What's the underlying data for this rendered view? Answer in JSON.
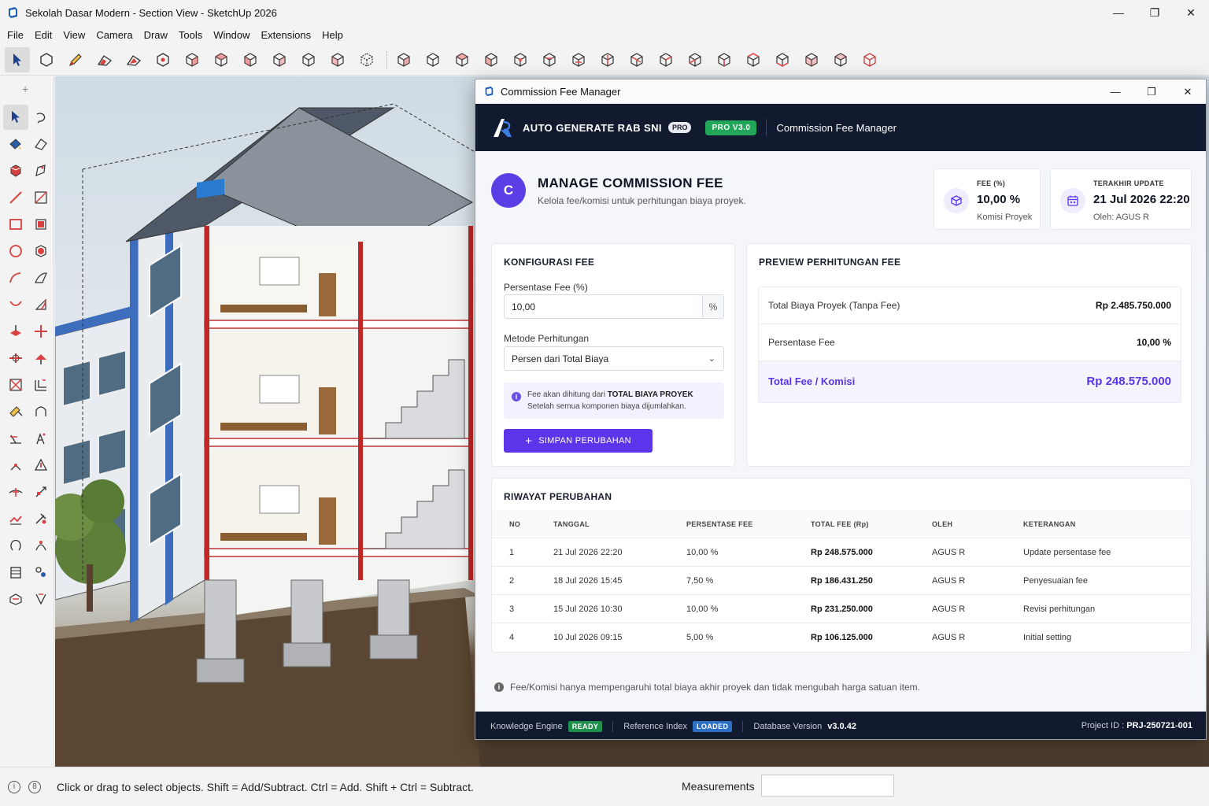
{
  "window": {
    "title": "Sekolah Dasar Modern - Section View - SketchUp 2026",
    "minimize": "—",
    "maximize": "❐",
    "close": "✕"
  },
  "menu": [
    "File",
    "Edit",
    "View",
    "Camera",
    "Draw",
    "Tools",
    "Window",
    "Extensions",
    "Help"
  ],
  "left_tools_plus": "+",
  "statusbar": {
    "message": "Click or drag to select objects. Shift = Add/Subtract. Ctrl = Add. Shift + Ctrl = Subtract.",
    "measurements_label": "Measurements",
    "measurements_value": ""
  },
  "dialog": {
    "title": "Commission Fee Manager",
    "header": {
      "brand": "AUTO GENERATE RAB SNI",
      "pro_badge": "PRO",
      "version_badge": "PRO  V3.0",
      "subtitle": "Commission Fee Manager"
    },
    "manage": {
      "avatar": "C",
      "title": "MANAGE COMMISSION FEE",
      "subtitle": "Kelola fee/komisi untuk perhitungan biaya proyek."
    },
    "stats": {
      "fee": {
        "label": "FEE (%)",
        "value": "10,00 %",
        "sub": "Komisi Proyek"
      },
      "update": {
        "label": "TERAKHIR UPDATE",
        "value": "21 Jul 2026 22:20",
        "sub": "Oleh: AGUS R"
      }
    },
    "config": {
      "title": "KONFIGURASI FEE",
      "percent_label": "Persentase Fee (%)",
      "percent_value": "10,00",
      "percent_suffix": "%",
      "method_label": "Metode Perhitungan",
      "method_value": "Persen dari Total Biaya",
      "note_prefix": "Fee akan dihitung dari",
      "note_bold": "TOTAL BIAYA PROYEK",
      "note_line2": "Setelah semua komponen biaya dijumlahkan.",
      "save_label": "SIMPAN PERUBAHAN"
    },
    "preview": {
      "title": "PREVIEW PERHITUNGAN FEE",
      "rows": [
        {
          "label": "Total Biaya Proyek (Tanpa Fee)",
          "value": "Rp 2.485.750.000"
        },
        {
          "label": "Persentase Fee",
          "value": "10,00 %"
        },
        {
          "label": "Total Fee / Komisi",
          "value": "Rp 248.575.000"
        }
      ]
    },
    "history": {
      "title": "RIWAYAT PERUBAHAN",
      "columns": [
        "NO",
        "TANGGAL",
        "PERSENTASE FEE",
        "TOTAL FEE (Rp)",
        "OLEH",
        "KETERANGAN"
      ],
      "rows": [
        {
          "no": "1",
          "date": "21 Jul 2026 22:20",
          "pct": "10,00 %",
          "fee": "Rp 248.575.000",
          "by": "AGUS R",
          "note": "Update persentase fee"
        },
        {
          "no": "2",
          "date": "18 Jul 2026 15:45",
          "pct": "7,50 %",
          "fee": "Rp 186.431.250",
          "by": "AGUS R",
          "note": "Penyesuaian fee"
        },
        {
          "no": "3",
          "date": "15 Jul 2026 10:30",
          "pct": "10,00 %",
          "fee": "Rp 231.250.000",
          "by": "AGUS R",
          "note": "Revisi perhitungan"
        },
        {
          "no": "4",
          "date": "10 Jul 2026 09:15",
          "pct": "5,00 %",
          "fee": "Rp 106.125.000",
          "by": "AGUS R",
          "note": "Initial setting"
        }
      ]
    },
    "footnote": "Fee/Komisi hanya mempengaruhi total biaya akhir proyek dan tidak mengubah harga satuan item.",
    "status": {
      "engine_label": "Knowledge Engine",
      "engine_badge": "READY",
      "index_label": "Reference Index",
      "index_badge": "LOADED",
      "db_label": "Database Version",
      "db_value": "v3.0.42",
      "project_label": "Project ID :",
      "project_value": "PRJ-250721-001"
    }
  },
  "colors": {
    "accent": "#5b35ea",
    "header_bg": "#111a2e",
    "ready_green": "#1f8f4e",
    "loaded_blue": "#2c6fc4"
  }
}
